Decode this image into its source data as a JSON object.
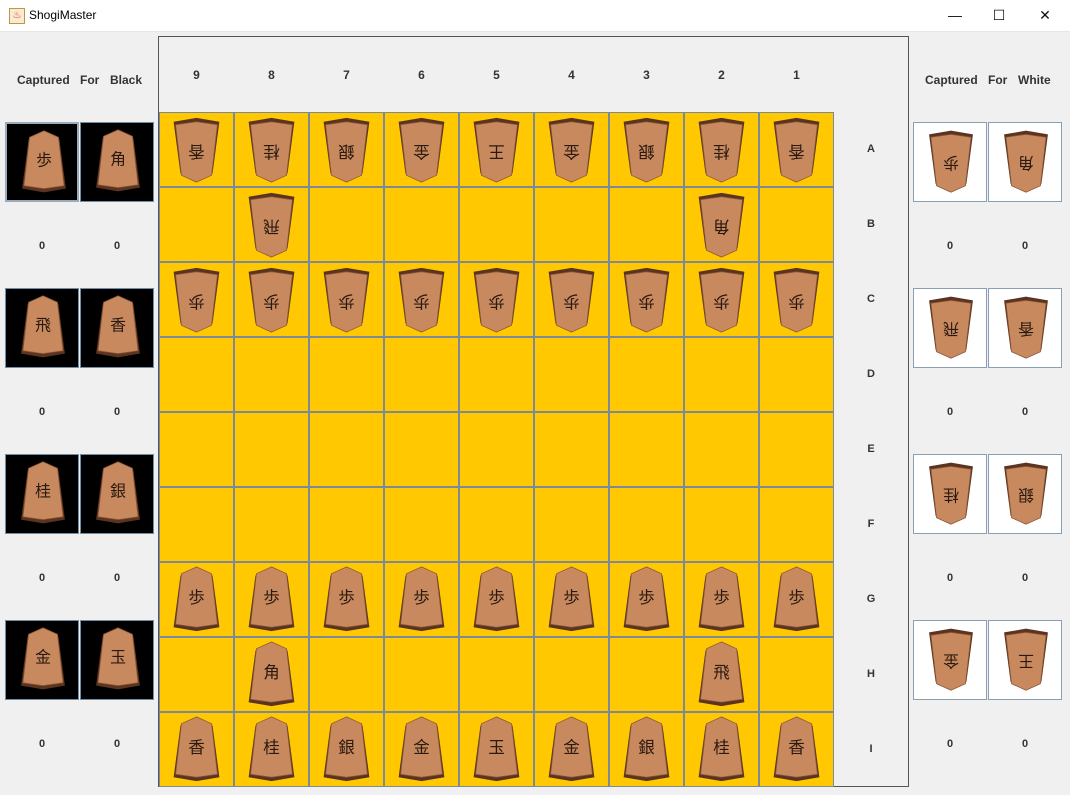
{
  "window": {
    "title": "ShogiMaster",
    "controls": {
      "minimize": "—",
      "maximize": "☐",
      "close": "✕"
    }
  },
  "captured_black": {
    "labels": [
      "Captured",
      "For",
      "Black"
    ],
    "rows": [
      {
        "pieces": [
          "歩",
          "角"
        ],
        "counts": [
          "0",
          "0"
        ]
      },
      {
        "pieces": [
          "飛",
          "香"
        ],
        "counts": [
          "0",
          "0"
        ]
      },
      {
        "pieces": [
          "桂",
          "銀"
        ],
        "counts": [
          "0",
          "0"
        ]
      },
      {
        "pieces": [
          "金",
          "玉"
        ],
        "counts": [
          "0",
          "0"
        ]
      }
    ]
  },
  "captured_white": {
    "labels": [
      "Captured",
      "For",
      "White"
    ],
    "rows": [
      {
        "pieces": [
          "歩",
          "角"
        ],
        "counts": [
          "0",
          "0"
        ]
      },
      {
        "pieces": [
          "飛",
          "香"
        ],
        "counts": [
          "0",
          "0"
        ]
      },
      {
        "pieces": [
          "桂",
          "銀"
        ],
        "counts": [
          "0",
          "0"
        ]
      },
      {
        "pieces": [
          "金",
          "王"
        ],
        "counts": [
          "0",
          "0"
        ]
      }
    ]
  },
  "board": {
    "files": [
      "9",
      "8",
      "7",
      "6",
      "5",
      "4",
      "3",
      "2",
      "1"
    ],
    "ranks": [
      "A",
      "B",
      "C",
      "D",
      "E",
      "F",
      "G",
      "H",
      "I"
    ],
    "rows": [
      [
        "w:香",
        "w:桂",
        "w:銀",
        "w:金",
        "w:王",
        "w:金",
        "w:銀",
        "w:桂",
        "w:香"
      ],
      [
        "",
        "w:飛",
        "",
        "",
        "",
        "",
        "",
        "w:角",
        ""
      ],
      [
        "w:歩",
        "w:歩",
        "w:歩",
        "w:歩",
        "w:歩",
        "w:歩",
        "w:歩",
        "w:歩",
        "w:歩"
      ],
      [
        "",
        "",
        "",
        "",
        "",
        "",
        "",
        "",
        ""
      ],
      [
        "",
        "",
        "",
        "",
        "",
        "",
        "",
        "",
        ""
      ],
      [
        "",
        "",
        "",
        "",
        "",
        "",
        "",
        "",
        ""
      ],
      [
        "b:歩",
        "b:歩",
        "b:歩",
        "b:歩",
        "b:歩",
        "b:歩",
        "b:歩",
        "b:歩",
        "b:歩"
      ],
      [
        "",
        "b:角",
        "",
        "",
        "",
        "",
        "",
        "b:飛",
        ""
      ],
      [
        "b:香",
        "b:桂",
        "b:銀",
        "b:金",
        "b:玉",
        "b:金",
        "b:銀",
        "b:桂",
        "b:香"
      ]
    ]
  },
  "colors": {
    "board_square": "#ffc800",
    "piece_wood": "#c8895e",
    "black_tray_bg": "#000000",
    "white_tray_bg": "#ffffff"
  }
}
